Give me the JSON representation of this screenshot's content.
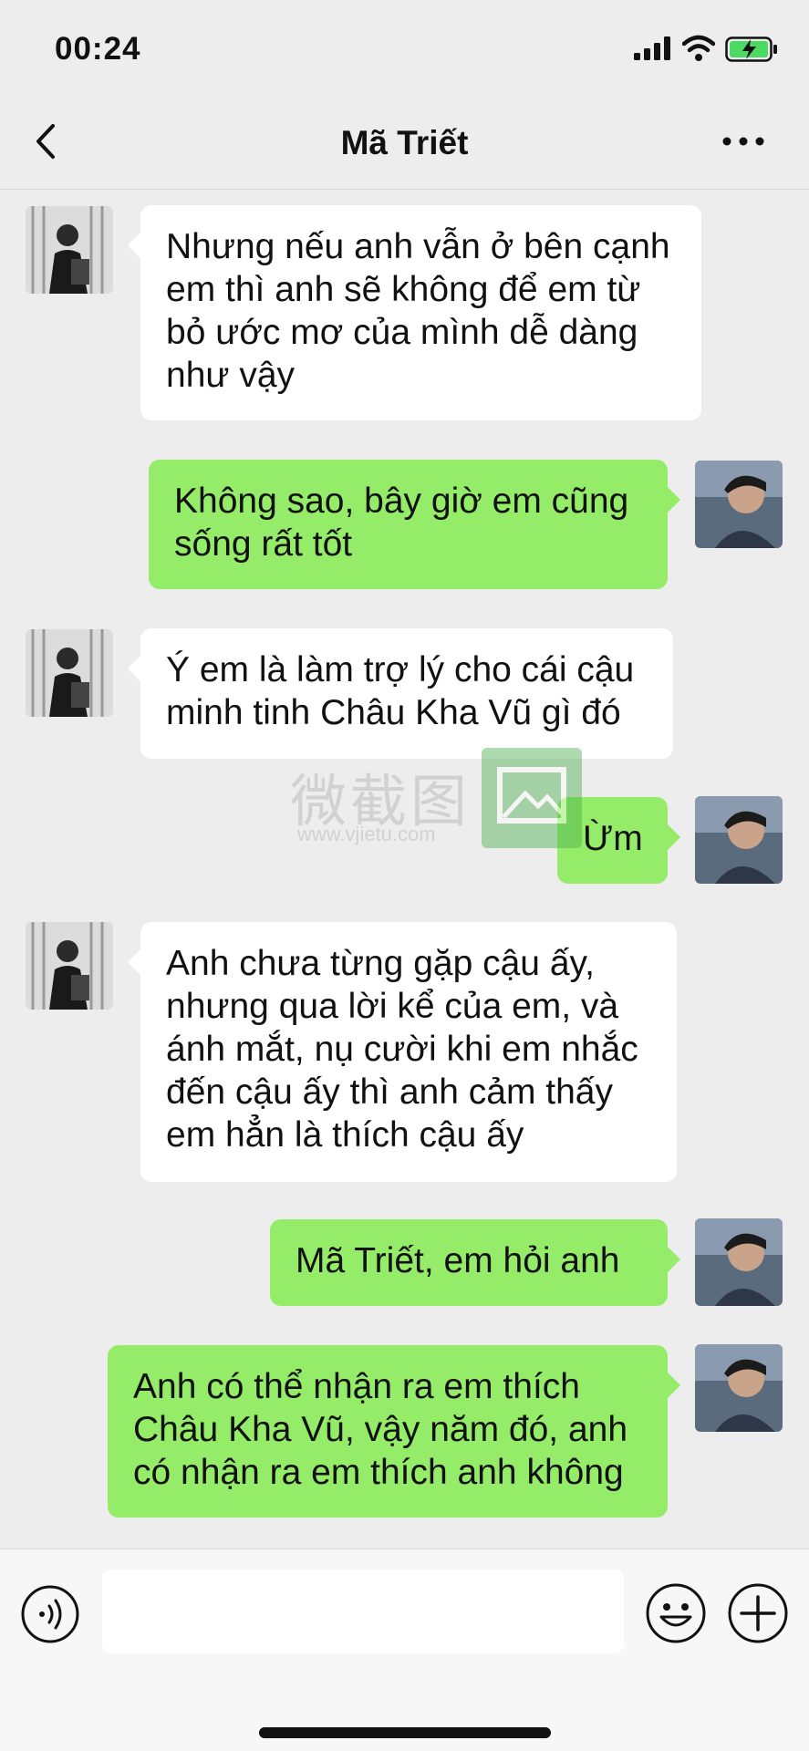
{
  "status_bar": {
    "time": "00:24",
    "icons": [
      "signal-icon",
      "wifi-icon",
      "battery-charging-icon"
    ]
  },
  "nav": {
    "title": "Mã Triết",
    "back_icon": "chevron-left-icon",
    "more_icon": "more-dots-icon"
  },
  "colors": {
    "incoming_bubble": "#ffffff",
    "outgoing_bubble": "#95ec69",
    "background": "#ededed"
  },
  "messages": [
    {
      "side": "in",
      "text": "Nhưng nếu anh vẫn ở bên cạnh em thì anh sẽ không để em từ bỏ ước mơ của mình dễ dàng như vậy"
    },
    {
      "side": "out",
      "text": "Không sao, bây giờ em cũng sống rất tốt"
    },
    {
      "side": "in",
      "text": "Ý em là làm trợ lý cho cái cậu minh tinh Châu Kha Vũ gì đó"
    },
    {
      "side": "out",
      "text": "Ừm"
    },
    {
      "side": "in",
      "text": "Anh chưa từng gặp cậu ấy, nhưng qua lời kể của em, và ánh mắt, nụ cười khi em nhắc đến cậu ấy thì anh cảm thấy em hẳn là thích cậu ấy"
    },
    {
      "side": "out",
      "text": "Mã Triết, em hỏi anh"
    },
    {
      "side": "out",
      "text": "Anh có thể nhận ra em thích Châu Kha Vũ, vậy năm đó, anh có nhận ra em thích anh không"
    }
  ],
  "watermark": {
    "text": "微截图",
    "url": "www.vjietu.com"
  },
  "input_bar": {
    "voice_icon": "voice-icon",
    "emoji_icon": "emoji-icon",
    "plus_icon": "plus-icon",
    "input_value": ""
  }
}
